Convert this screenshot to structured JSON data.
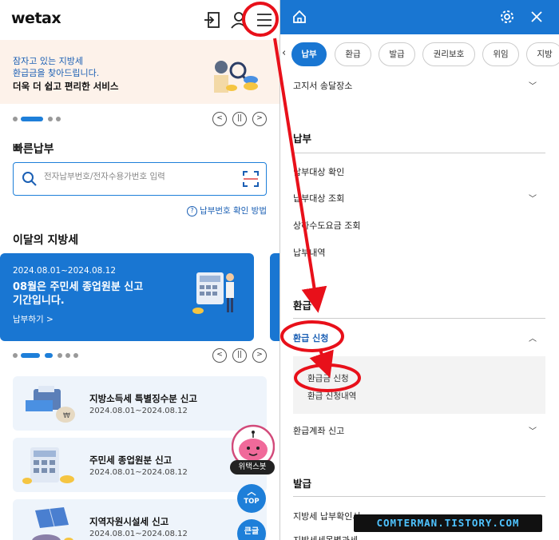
{
  "left": {
    "logo": "wetax",
    "banner": {
      "line1": "잠자고 있는 지방세",
      "line2": "환급금을 찾아드립니다.",
      "line3": "더욱 더 쉽고 편리한 서비스"
    },
    "quick_pay": {
      "title": "빠른납부",
      "placeholder": "전자납부번호/전자수용가번호 입력",
      "help_link": "납부번호 확인 방법"
    },
    "monthly": {
      "title": "이달의 지방세",
      "card_date": "2024.08.01~2024.08.12",
      "card_line1": "08월은 주민세 종업원분 신고",
      "card_line2": "기간입니다.",
      "card_link": "납부하기 >"
    },
    "tax_items": [
      {
        "name": "지방소득세 특별징수분 신고",
        "date": "2024.08.01~2024.08.12"
      },
      {
        "name": "주민세 종업원분 신고",
        "date": "2024.08.01~2024.08.12"
      },
      {
        "name": "지역자원시설세 신고",
        "date": "2024.08.01~2024.08.12"
      }
    ],
    "bot_label": "위택스봇",
    "top_button": "TOP",
    "big_button": "큰글"
  },
  "right": {
    "tabs": [
      {
        "label": "납부",
        "active": true
      },
      {
        "label": "환급",
        "active": false
      },
      {
        "label": "발급",
        "active": false
      },
      {
        "label": "권리보호",
        "active": false
      },
      {
        "label": "위임",
        "active": false
      },
      {
        "label": "지방",
        "active": false
      }
    ],
    "first_item": "고지서 송달장소",
    "categories": [
      {
        "title": "납부",
        "items": [
          "납부대상 확인",
          "납부대상 조회",
          "상하수도요금 조회",
          "납부내역"
        ]
      },
      {
        "title": "환급",
        "expanded_item": "환급 신청",
        "sub_items": [
          "환급금 신청",
          "환급 신청내역"
        ],
        "items": [
          "환급계좌 신고"
        ]
      },
      {
        "title": "발급",
        "items": [
          "지방세 납부확인서",
          "지방세세목별과세"
        ]
      }
    ],
    "watermark": "COMTERMAN.TISTORY.COM"
  },
  "colors": {
    "primary": "#1976d2",
    "annotation": "#e8101a",
    "banner_bg": "#fdf2ea",
    "card_bg": "#eef4fb"
  }
}
